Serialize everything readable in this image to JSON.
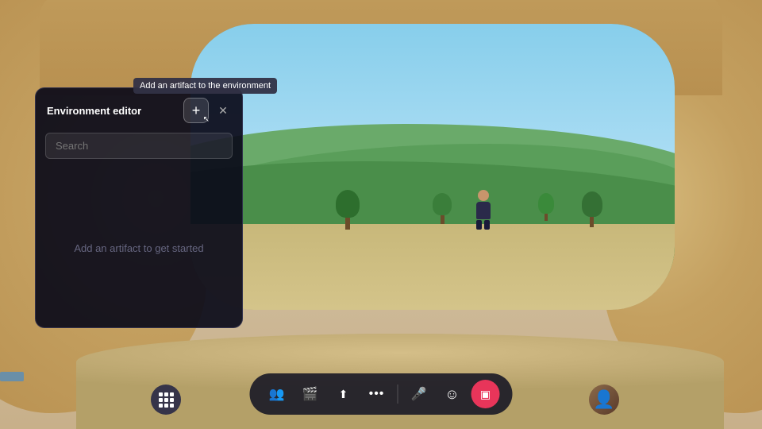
{
  "scene": {
    "bg_color": "#c8b89a"
  },
  "tooltip": {
    "text": "Add an artifact to the environment"
  },
  "panel": {
    "title": "Environment editor",
    "add_button_label": "+",
    "close_label": "✕",
    "search_placeholder": "Search",
    "empty_message": "Add an artifact to get started"
  },
  "toolbar": {
    "buttons": [
      {
        "id": "people",
        "label": "👥",
        "active": false
      },
      {
        "id": "camera",
        "label": "🎬",
        "active": false
      },
      {
        "id": "share",
        "label": "⬆",
        "active": false
      },
      {
        "id": "more",
        "label": "•••",
        "active": false
      },
      {
        "id": "mic",
        "label": "🎤",
        "active": false
      },
      {
        "id": "emoji",
        "label": "☺",
        "active": false
      },
      {
        "id": "screen",
        "label": "▣",
        "active": true
      }
    ]
  },
  "grid_button": {
    "label": "⊞"
  }
}
